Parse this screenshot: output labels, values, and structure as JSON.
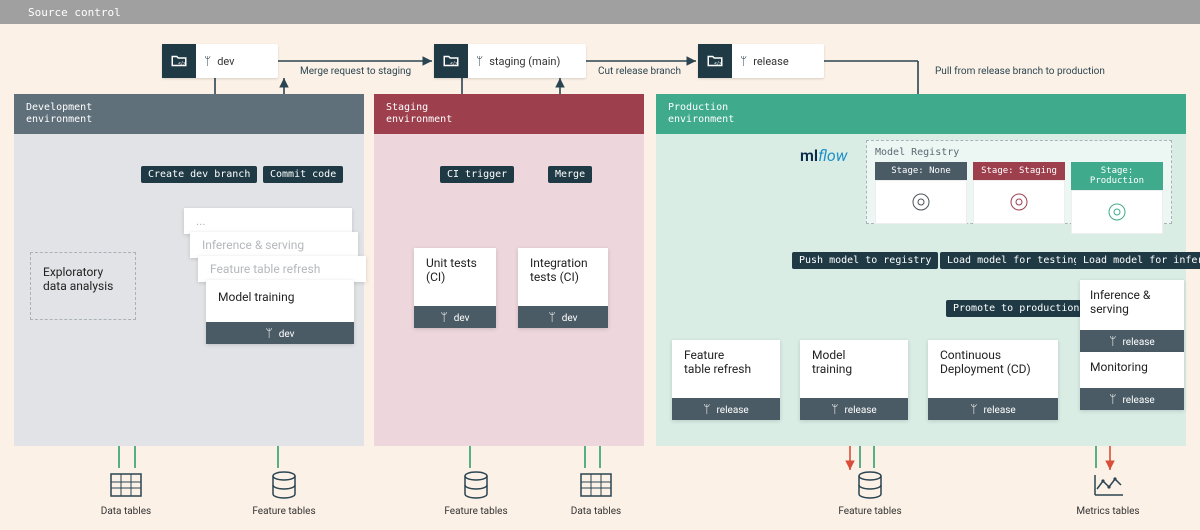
{
  "source_control_label": "Source control",
  "repos": {
    "dev": "dev",
    "staging": "staging (main)",
    "release": "release"
  },
  "flow": {
    "merge_to_staging": "Merge request to staging",
    "cut_release": "Cut release branch",
    "pull_to_prod": "Pull from release branch to production",
    "create_dev_branch": "Create dev branch",
    "commit_code": "Commit code",
    "ci_trigger": "CI trigger",
    "merge": "Merge"
  },
  "envs": {
    "dev": "Development\nenvironment",
    "stg": "Staging\nenvironment",
    "prd": "Production\nenvironment"
  },
  "dev_cards": {
    "eda": "Exploratory\ndata analysis",
    "stack_dots": "...",
    "inference": "Inference & serving",
    "feat_refresh": "Feature table refresh",
    "model_training": "Model training",
    "branch": "dev"
  },
  "stg_cards": {
    "unit": "Unit tests\n(CI)",
    "integration": "Integration\ntests (CI)",
    "branch": "dev"
  },
  "registry": {
    "logo": "mlflow",
    "title": "Model Registry",
    "stages": [
      "Stage: None",
      "Stage: Staging",
      "Stage: Production"
    ]
  },
  "prod_labels": {
    "push": "Push model to registry",
    "load_test": "Load model for testing",
    "load_inf": "Load model for inference",
    "promote": "Promote to production"
  },
  "prod_cards": {
    "feat_refresh": "Feature\ntable refresh",
    "model_training": "Model\ntraining",
    "cd": "Continuous\nDeployment (CD)",
    "inference": "Inference & serving",
    "monitoring": "Monitoring",
    "branch": "release"
  },
  "footer": {
    "data_tables": "Data tables",
    "feature_tables": "Feature tables",
    "metrics_tables": "Metrics tables"
  }
}
